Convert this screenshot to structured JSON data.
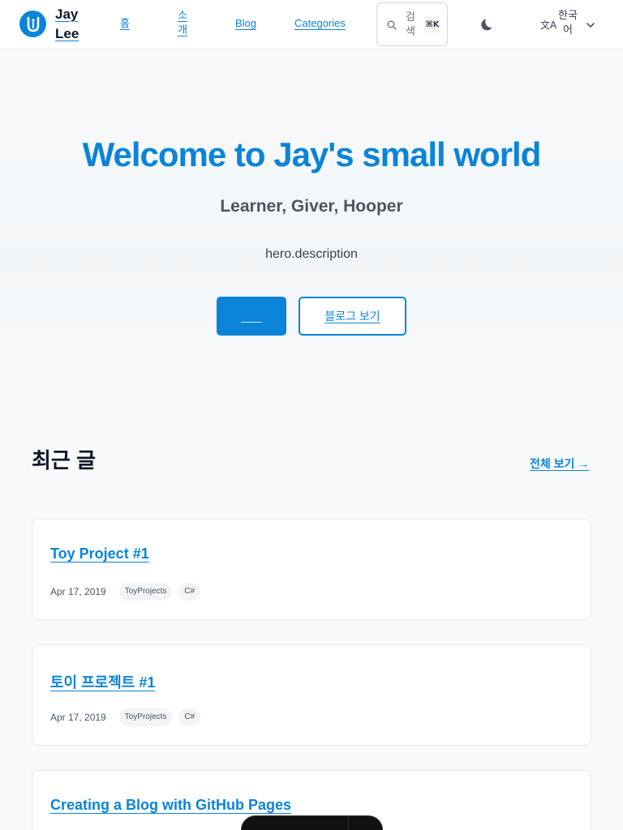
{
  "header": {
    "brand": "Jay Lee",
    "nav": {
      "home": "홈",
      "about": "소개",
      "blog": "Blog",
      "categories": "Categories"
    },
    "search": {
      "label": "검색",
      "shortcut": "⌘K"
    },
    "language": "한국어"
  },
  "hero": {
    "title": "Welcome to Jay's small world",
    "subtitle": "Learner, Giver, Hooper",
    "description": "hero.description",
    "primary_button": "",
    "secondary_button": "블로그 보기"
  },
  "recent": {
    "title": "최근 글",
    "view_all": "전체 보기 →",
    "posts": [
      {
        "title": "Toy Project #1",
        "date": "Apr 17, 2019",
        "tags": [
          "ToyProjects",
          "C#"
        ]
      },
      {
        "title": "토이 프로젝트 #1",
        "date": "Apr 17, 2019",
        "tags": [
          "ToyProjects",
          "C#"
        ]
      },
      {
        "title": "Creating a Blog with GitHub Pages",
        "date": "",
        "tags": []
      }
    ]
  },
  "colors": {
    "accent": "#0b84d8",
    "background": "#f8fafc"
  },
  "icons": {
    "logo": "logo-icon",
    "search": "search-icon",
    "theme": "moon-icon",
    "translate": "translate-icon",
    "chevron": "chevron-down-icon"
  }
}
